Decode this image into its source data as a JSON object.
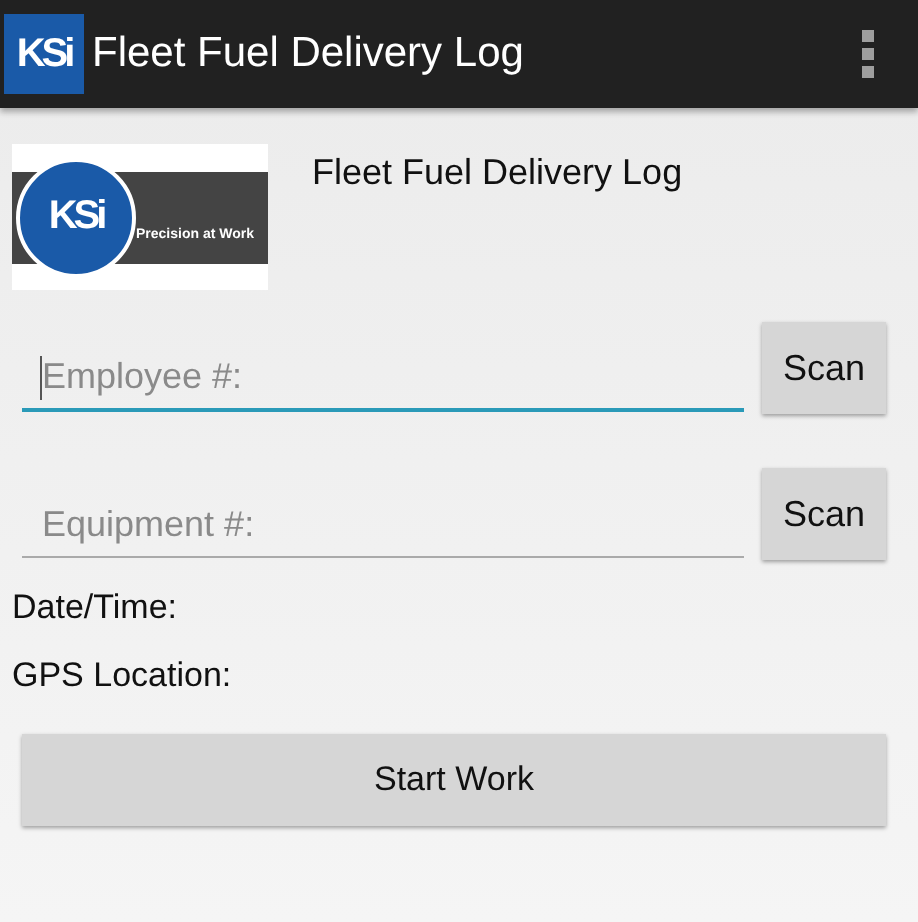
{
  "app_bar": {
    "logo_text": "KSi",
    "title": "Fleet Fuel Delivery Log"
  },
  "header": {
    "logo": {
      "mark": "KSi",
      "tagline": "Precision at Work"
    },
    "title": "Fleet Fuel Delivery Log"
  },
  "fields": [
    {
      "placeholder": "Employee #:",
      "focused": true,
      "button": "Scan"
    },
    {
      "placeholder": "Equipment #:",
      "focused": false,
      "button": "Scan"
    }
  ],
  "info": [
    "Date/Time:",
    "GPS Location:"
  ],
  "start_button": "Start Work"
}
